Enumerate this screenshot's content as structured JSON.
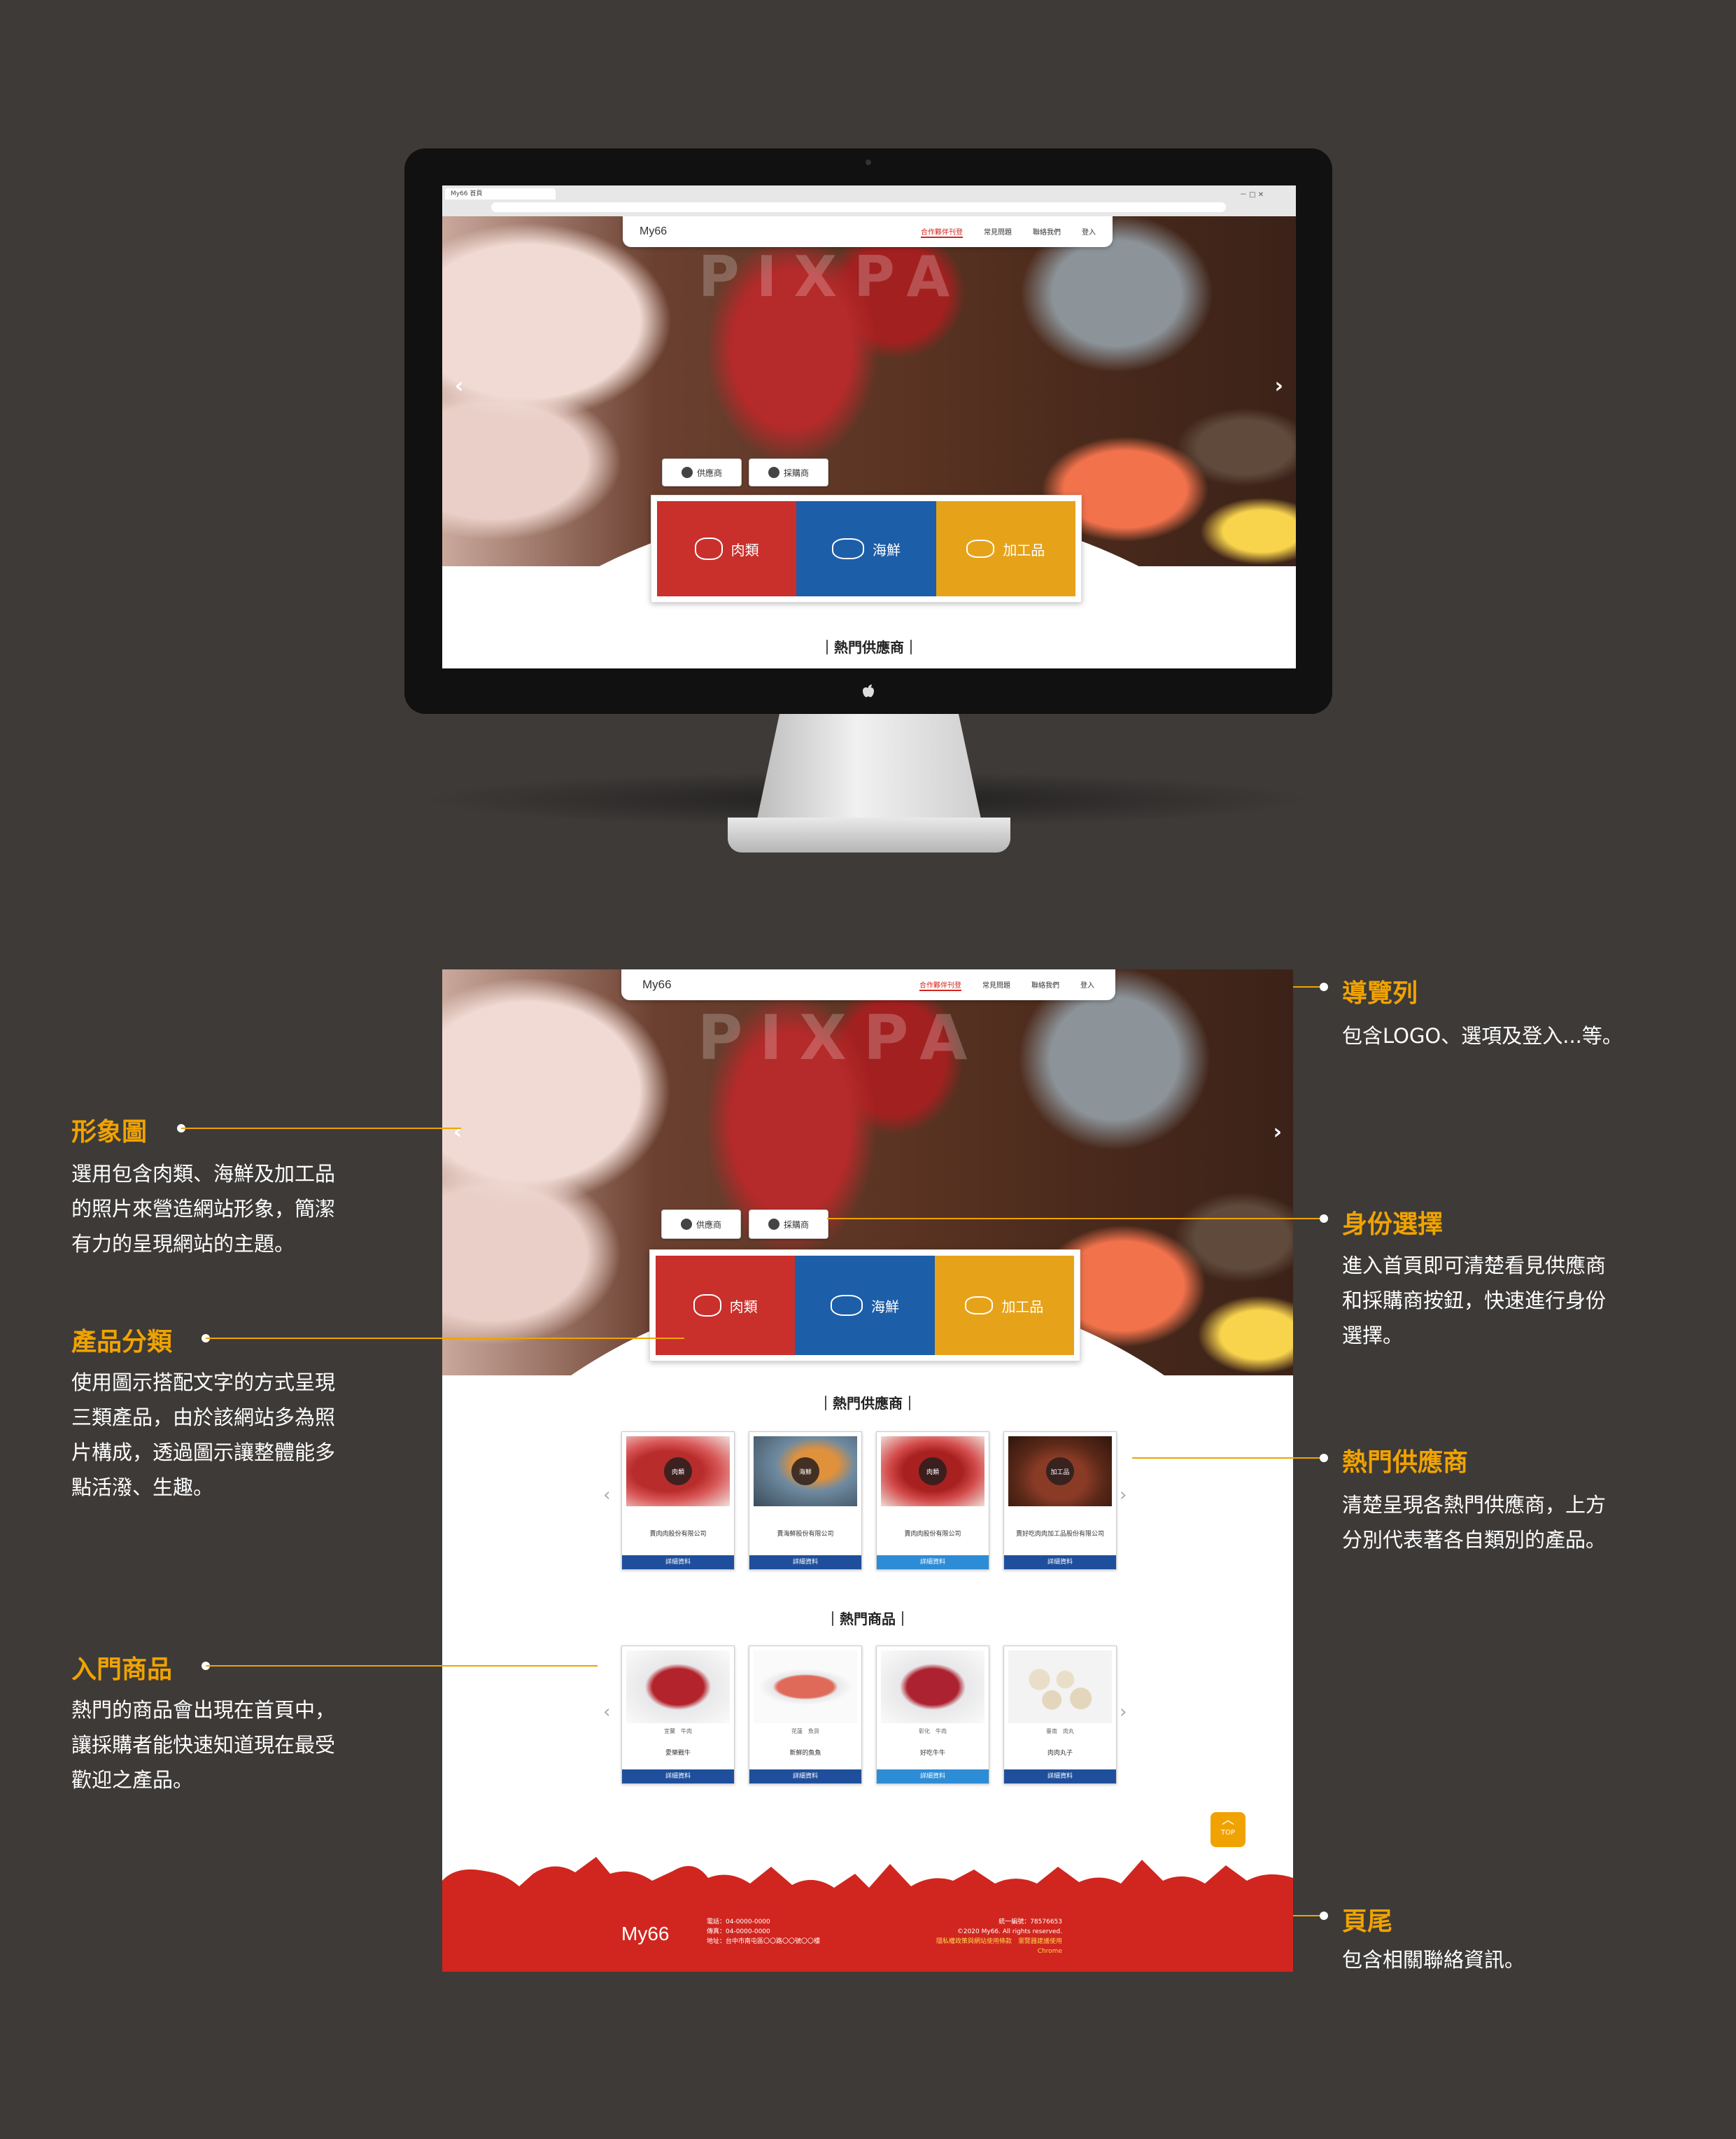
{
  "browser": {
    "tab_title": "My66 首頁",
    "win_controls": "－  □  ✕"
  },
  "site": {
    "logo": "My66",
    "nav": [
      {
        "label": "合作夥伴刊登",
        "active": true
      },
      {
        "label": "常見問題",
        "active": false
      },
      {
        "label": "聯絡我們",
        "active": false
      },
      {
        "label": "登入",
        "active": false
      }
    ],
    "watermark": "PIXPA",
    "identity": {
      "supplier": "供應商",
      "buyer": "採購商"
    },
    "categories": [
      {
        "label": "肉類",
        "color": "#c9302c"
      },
      {
        "label": "海鮮",
        "color": "#1d5ea9"
      },
      {
        "label": "加工品",
        "color": "#e6a31a"
      }
    ],
    "hot_suppliers_title": "熱門供應商",
    "suppliers": [
      {
        "badge": "肉類",
        "name": "賣肉肉股份有限公司",
        "button": "詳細資料"
      },
      {
        "badge": "海鮮",
        "name": "賣海鮮股份有限公司",
        "button": "詳細資料"
      },
      {
        "badge": "肉類",
        "name": "賣肉肉股份有限公司",
        "button": "詳細資料"
      },
      {
        "badge": "加工品",
        "name": "賣好吃肉肉加工品股份有限公司",
        "button": "詳細資料"
      }
    ],
    "hot_products_title": "熱門商品",
    "products": [
      {
        "meta": "宜蘭　牛肉",
        "name": "愛樂戰牛",
        "button": "詳細資料"
      },
      {
        "meta": "花蓮　魚貨",
        "name": "新鮮的魚魚",
        "button": "詳細資料"
      },
      {
        "meta": "彰化　牛肉",
        "name": "好吃牛牛",
        "button": "詳細資料"
      },
      {
        "meta": "臺南　肉丸",
        "name": "肉肉丸子",
        "button": "詳細資料"
      }
    ],
    "top_button": "TOP",
    "footer": {
      "logo": "My66",
      "phone": "電話：04-0000-0000",
      "fax": "傳真：04-0000-0000",
      "address": "地址：台中市南屯區〇〇路〇〇號〇〇樓",
      "tax_id": "統一編號：78576653",
      "copyright": "©2020 My66. All rights reserved.",
      "link1": "隱私權政策與網站使用條款",
      "link2": "瀏覽器建議使用 Chrome"
    }
  },
  "annotations": [
    {
      "title": "導覽列",
      "desc": [
        "包含LOGO、選項及登入...等。"
      ]
    },
    {
      "title": "形象圖",
      "desc": [
        "選用包含肉類、海鮮及加工品",
        "的照片來營造網站形象，簡潔",
        "有力的呈現網站的主題。"
      ]
    },
    {
      "title": "身份選擇",
      "desc": [
        "進入首頁即可清楚看見供應商",
        "和採購商按鈕，快速進行身份",
        "選擇。"
      ]
    },
    {
      "title": "產品分類",
      "desc": [
        "使用圖示搭配文字的方式呈現",
        "三類產品，由於該網站多為照",
        "片構成，透過圖示讓整體能多",
        "點活潑、生趣。"
      ]
    },
    {
      "title": "熱門供應商",
      "desc": [
        "清楚呈現各熱門供應商，上方",
        "分別代表著各自類別的產品。"
      ]
    },
    {
      "title": "入門商品",
      "desc": [
        "熱門的商品會出現在首頁中，",
        "讓採購者能快速知道現在最受",
        "歡迎之產品。"
      ]
    },
    {
      "title": "頁尾",
      "desc": [
        "包含相關聯絡資訊。"
      ]
    }
  ]
}
